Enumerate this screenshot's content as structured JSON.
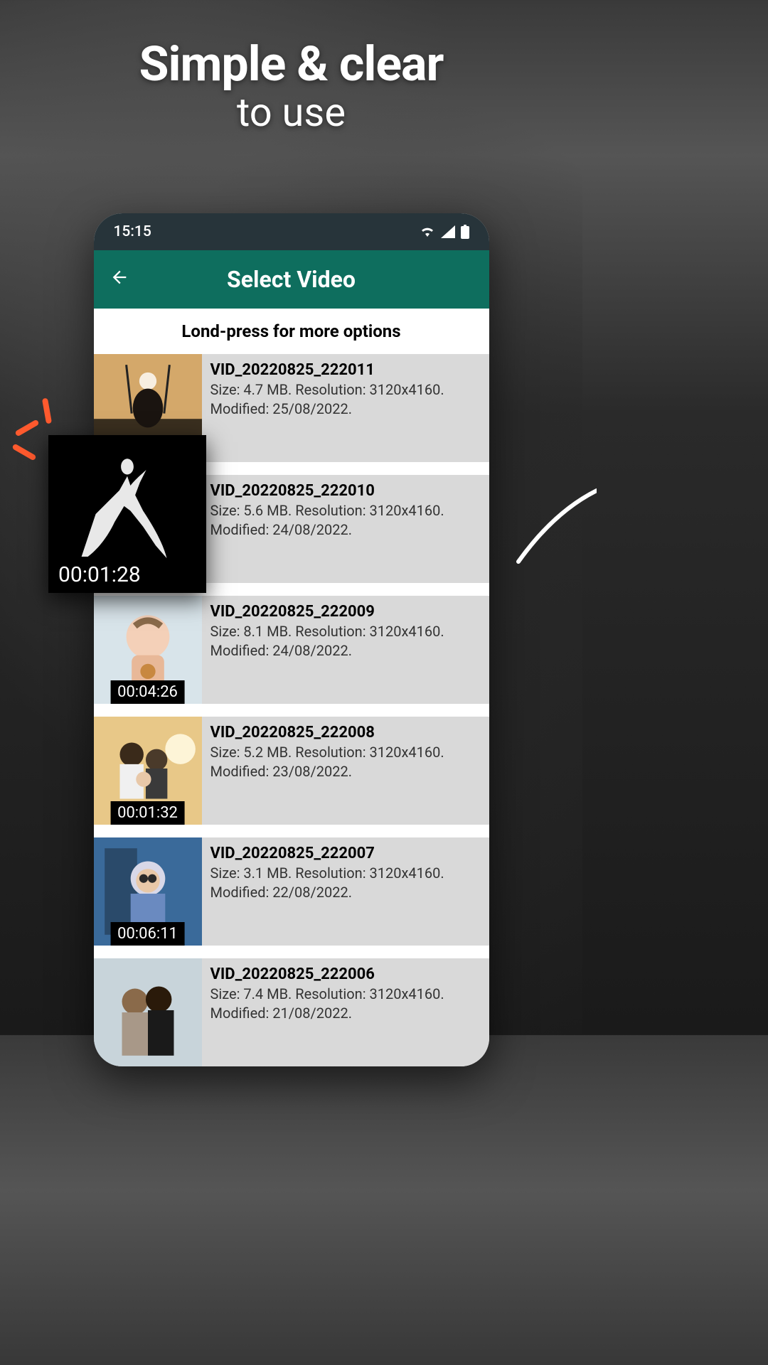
{
  "promo": {
    "line1": "Simple & clear",
    "line2": "to use"
  },
  "status": {
    "time": "15:15"
  },
  "appbar": {
    "title": "Select Video"
  },
  "hint": "Lond-press for more options",
  "popout": {
    "duration": "00:01:28"
  },
  "videos": [
    {
      "name": "VID_20220825_222011",
      "info": "Size: 4.7 MB. Resolution: 3120x4160. Modified: 25/08/2022.",
      "duration": ""
    },
    {
      "name": "VID_20220825_222010",
      "info": "Size: 5.6 MB. Resolution: 3120x4160. Modified: 24/08/2022.",
      "duration": ""
    },
    {
      "name": "VID_20220825_222009",
      "info": "Size: 8.1 MB. Resolution: 3120x4160. Modified: 24/08/2022.",
      "duration": "00:04:26"
    },
    {
      "name": "VID_20220825_222008",
      "info": "Size: 5.2 MB. Resolution: 3120x4160. Modified: 23/08/2022.",
      "duration": "00:01:32"
    },
    {
      "name": "VID_20220825_222007",
      "info": "Size: 3.1 MB. Resolution: 3120x4160. Modified: 22/08/2022.",
      "duration": "00:06:11"
    },
    {
      "name": "VID_20220825_222006",
      "info": "Size: 7.4 MB. Resolution: 3120x4160. Modified: 21/08/2022.",
      "duration": ""
    }
  ]
}
